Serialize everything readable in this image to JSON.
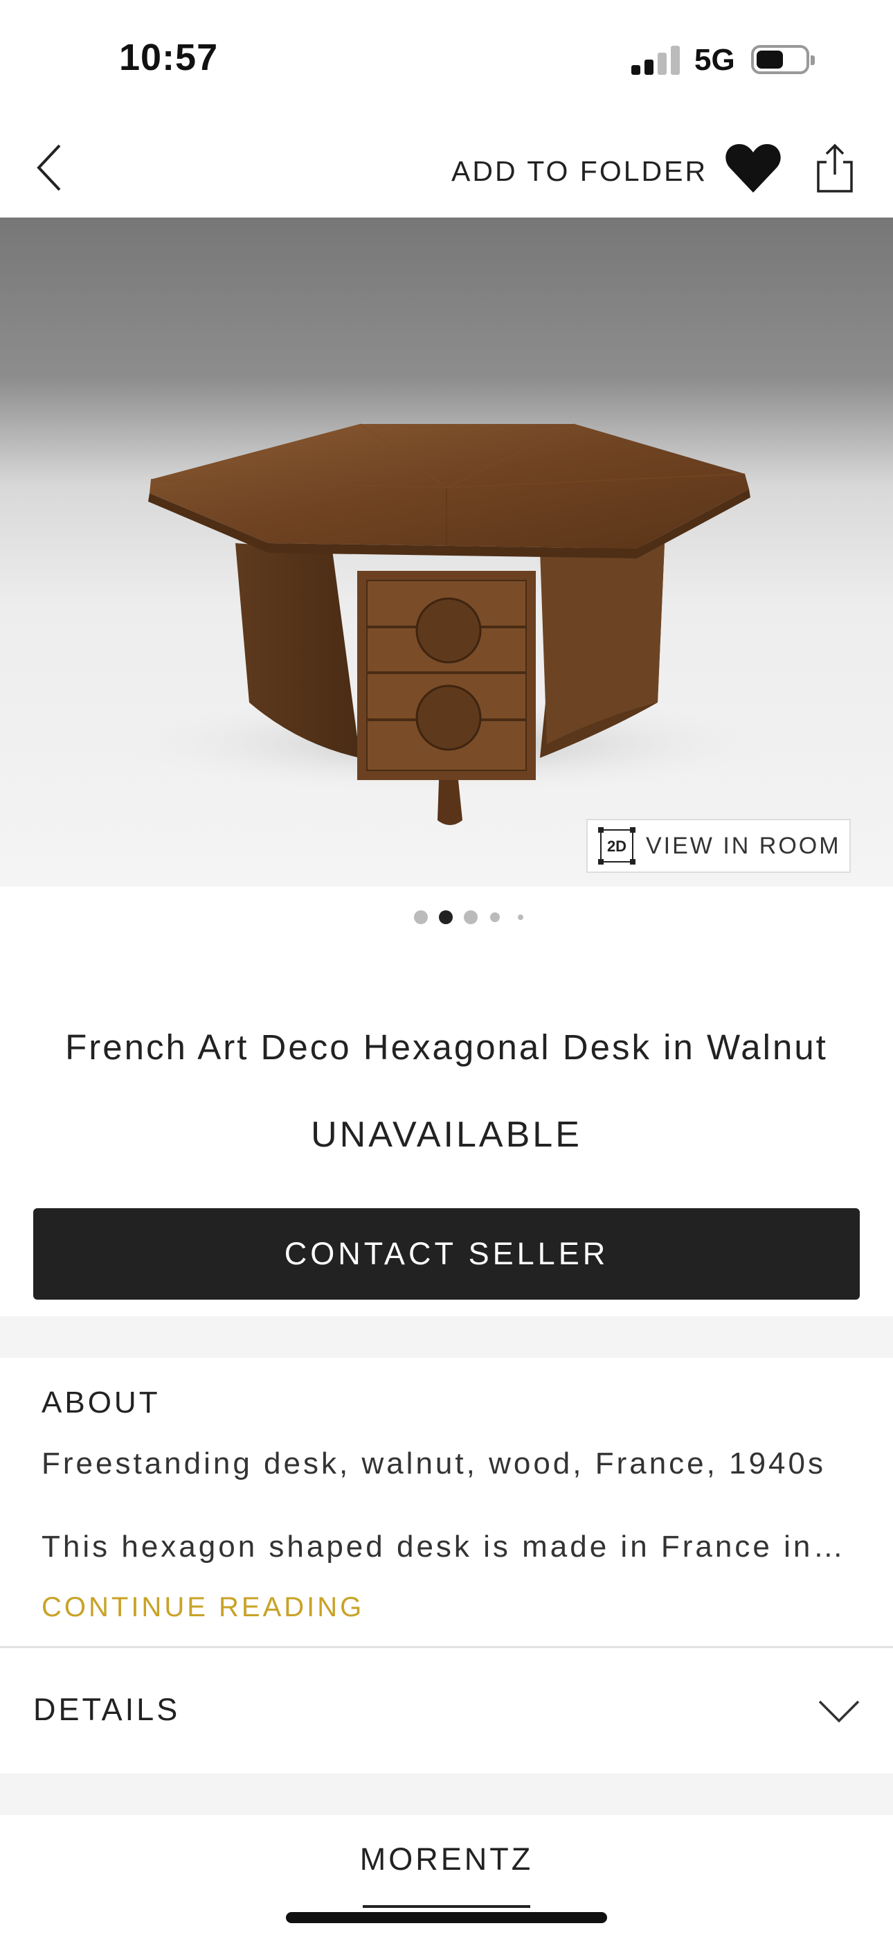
{
  "status_bar": {
    "time": "10:57",
    "network": "5G"
  },
  "nav": {
    "add_to_folder": "ADD TO FOLDER",
    "back_icon": "chevron-left-icon",
    "favorite_icon": "heart-icon",
    "share_icon": "share-icon"
  },
  "hero": {
    "view_in_room_badge": "2D",
    "view_in_room": "VIEW IN ROOM",
    "carousel_count": 5,
    "carousel_active": 2
  },
  "product": {
    "title": "French Art Deco Hexagonal Desk in Walnut",
    "availability": "UNAVAILABLE",
    "contact_label": "CONTACT SELLER"
  },
  "about": {
    "heading": "ABOUT",
    "summary": "Freestanding desk, walnut, wood, France, 1940s",
    "description": "This hexagon shaped desk is made in France in…",
    "continue_label": "CONTINUE READING"
  },
  "details": {
    "label": "DETAILS",
    "icon": "chevron-down-icon"
  },
  "tabs": {
    "seller": "MORENTZ"
  },
  "colors": {
    "accent": "#c9a227",
    "button_bg": "#222222",
    "text": "#222222"
  }
}
